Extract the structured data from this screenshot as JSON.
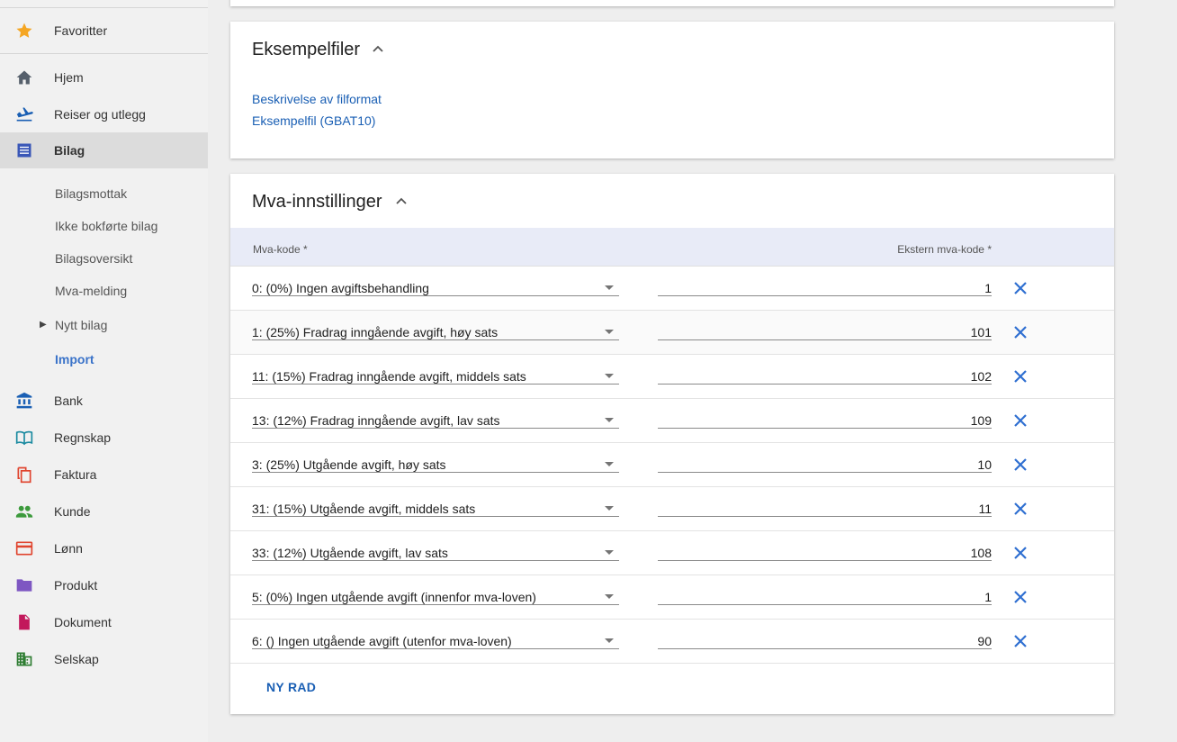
{
  "sidebar": {
    "favorites": "Favoritter",
    "items": [
      {
        "label": "Hjem",
        "icon": "home-icon",
        "color": "#555f6b"
      },
      {
        "label": "Reiser og utlegg",
        "icon": "flight-land-icon",
        "color": "#1a5fb4"
      },
      {
        "label": "Bilag",
        "icon": "document-list-icon",
        "color": "#3a57b7"
      },
      {
        "label": "Bank",
        "icon": "bank-icon",
        "color": "#1a5fb4"
      },
      {
        "label": "Regnskap",
        "icon": "book-icon",
        "color": "#1a8aa0"
      },
      {
        "label": "Faktura",
        "icon": "copy-icon",
        "color": "#e0442e"
      },
      {
        "label": "Kunde",
        "icon": "people-icon",
        "color": "#3c9a3c"
      },
      {
        "label": "Lønn",
        "icon": "card-icon",
        "color": "#e0442e"
      },
      {
        "label": "Produkt",
        "icon": "folder-icon",
        "color": "#7e57c2"
      },
      {
        "label": "Dokument",
        "icon": "file-icon",
        "color": "#c2185b"
      },
      {
        "label": "Selskap",
        "icon": "building-icon",
        "color": "#2e7d32"
      }
    ],
    "sub_items": [
      "Bilagsmottak",
      "Ikke bokførte bilag",
      "Bilagsoversikt",
      "Mva-melding",
      "Nytt bilag",
      "Import"
    ]
  },
  "examples": {
    "title": "Eksempelfiler",
    "links": [
      "Beskrivelse av filformat",
      "Eksempelfil (GBAT10)"
    ]
  },
  "vat": {
    "title": "Mva-innstillinger",
    "col_code": "Mva-kode *",
    "col_ext": "Ekstern mva-kode *",
    "rows": [
      {
        "code": "0: (0%) Ingen avgiftsbehandling",
        "ext": "1"
      },
      {
        "code": "1: (25%) Fradrag inngående avgift, høy sats",
        "ext": "101"
      },
      {
        "code": "11: (15%) Fradrag inngående avgift, middels sats",
        "ext": "102"
      },
      {
        "code": "13: (12%) Fradrag inngående avgift, lav sats",
        "ext": "109"
      },
      {
        "code": "3: (25%) Utgående avgift, høy sats",
        "ext": "10"
      },
      {
        "code": "31: (15%) Utgående avgift, middels sats",
        "ext": "11"
      },
      {
        "code": "33: (12%) Utgående avgift, lav sats",
        "ext": "108"
      },
      {
        "code": "5: (0%) Ingen utgående avgift (innenfor mva-loven)",
        "ext": "1"
      },
      {
        "code": "6: () Ingen utgående avgift (utenfor mva-loven)",
        "ext": "90"
      }
    ],
    "new_row": "NY RAD"
  },
  "colors": {
    "accent": "#1a5fb4",
    "delete": "#2f6fd1",
    "header_bg": "#e8ebf7"
  }
}
